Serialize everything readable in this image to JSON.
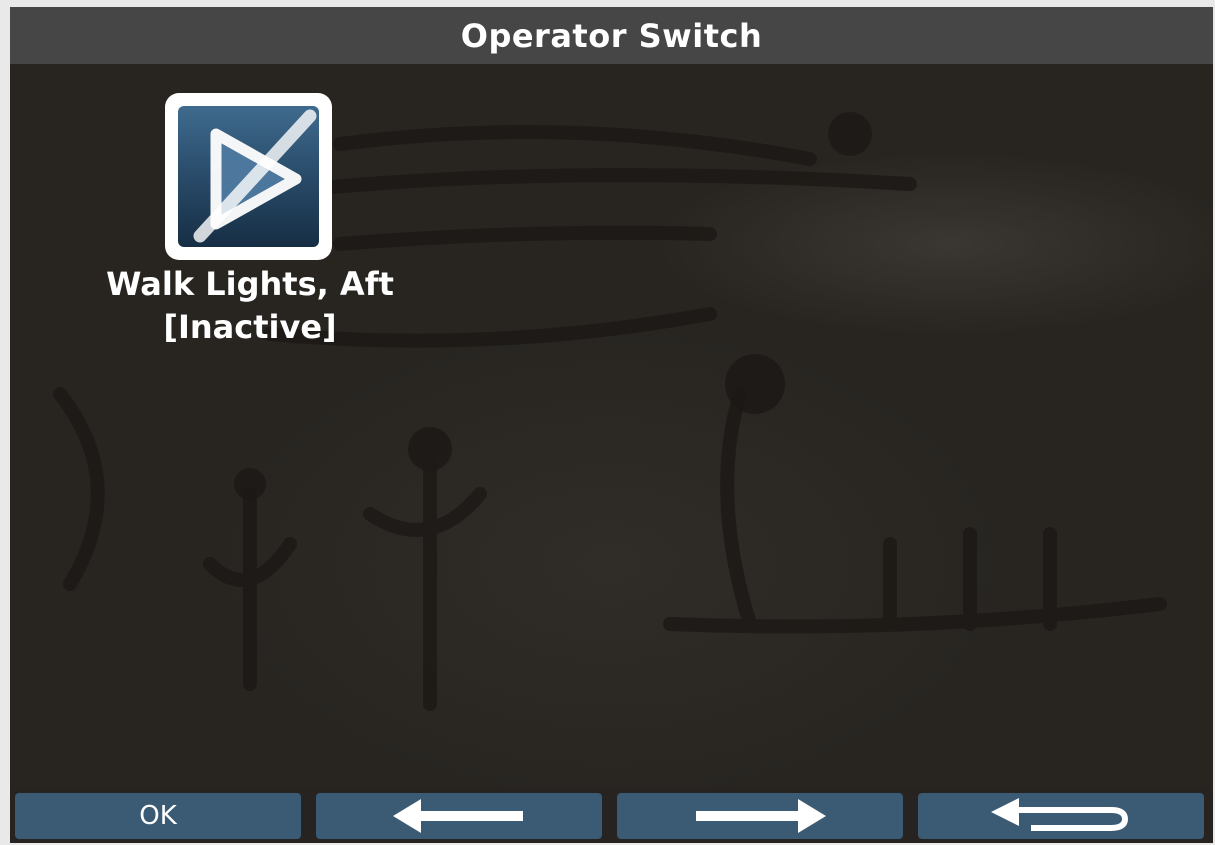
{
  "title": "Operator Switch",
  "switch": {
    "name": "Walk Lights, Aft",
    "state": "[Inactive]",
    "icon": "disabled-play-icon"
  },
  "buttons": {
    "ok_label": "OK",
    "back_icon": "arrow-left-icon",
    "forward_icon": "arrow-right-icon",
    "return_icon": "return-arrow-icon"
  },
  "colors": {
    "title_bar": "#464646",
    "button": "#3b5a74",
    "background": "#282521",
    "text": "#ffffff"
  }
}
